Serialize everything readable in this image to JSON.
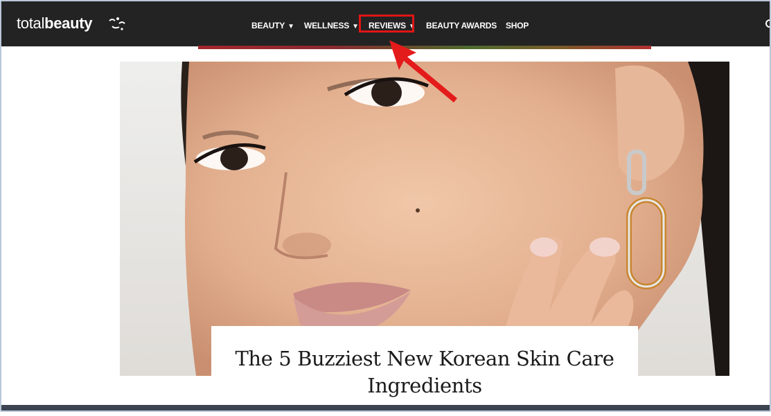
{
  "site": {
    "logo_light": "total",
    "logo_bold": "beauty"
  },
  "nav": {
    "items": [
      {
        "label": "BEAUTY",
        "caret": "▼"
      },
      {
        "label": "WELLNESS",
        "caret": "▼"
      },
      {
        "label": "REVIEWS",
        "caret": "▼"
      },
      {
        "label": "BEAUTY AWARDS",
        "caret": ""
      },
      {
        "label": "SHOP",
        "caret": ""
      }
    ],
    "highlighted": "REVIEWS"
  },
  "article": {
    "title": "The 5 Buzziest New Korean Skin Care Ingredients"
  },
  "icons": [
    "logo-mark-icon",
    "search-icon",
    "arrow-pointer-icon"
  ],
  "colors": {
    "navbar": "#232323",
    "highlight": "#e01515",
    "bottom_bar": "#3b4450"
  }
}
